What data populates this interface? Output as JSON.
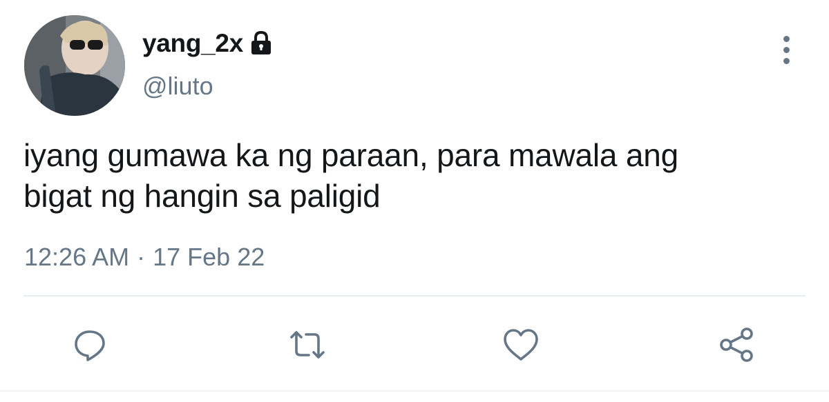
{
  "user": {
    "display_name": "yang_2x",
    "handle": "@liuto",
    "avatar": "avatar-photo",
    "protected_icon": "lock-icon"
  },
  "tweet": {
    "text_line1": "iyang gumawa ka ng paraan, para mawala ang",
    "text_line2": "bigat ng hangin sa paligid",
    "time": "12:26 AM",
    "separator": "·",
    "date": "17 Feb 22"
  },
  "actions": {
    "reply_icon": "reply-icon",
    "retweet_icon": "retweet-icon",
    "like_icon": "heart-icon",
    "share_icon": "share-icon",
    "more_icon": "more-vertical-icon"
  },
  "colors": {
    "text_primary": "#14171a",
    "text_secondary": "#657786",
    "divider": "#e6ecf0"
  }
}
